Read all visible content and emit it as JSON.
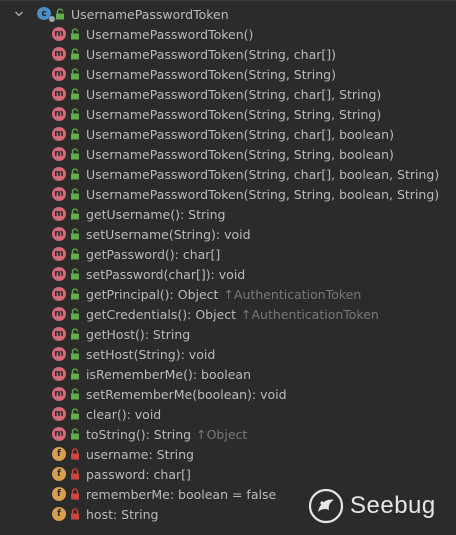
{
  "tree": {
    "root": {
      "label": "UsernamePasswordToken",
      "icon": "class-icon",
      "expanded": true
    },
    "members": [
      {
        "kind": "m",
        "access": "public",
        "label": "UsernamePasswordToken()",
        "inherited": ""
      },
      {
        "kind": "m",
        "access": "public",
        "label": "UsernamePasswordToken(String, char[])",
        "inherited": ""
      },
      {
        "kind": "m",
        "access": "public",
        "label": "UsernamePasswordToken(String, String)",
        "inherited": ""
      },
      {
        "kind": "m",
        "access": "public",
        "label": "UsernamePasswordToken(String, char[], String)",
        "inherited": ""
      },
      {
        "kind": "m",
        "access": "public",
        "label": "UsernamePasswordToken(String, String, String)",
        "inherited": ""
      },
      {
        "kind": "m",
        "access": "public",
        "label": "UsernamePasswordToken(String, char[], boolean)",
        "inherited": ""
      },
      {
        "kind": "m",
        "access": "public",
        "label": "UsernamePasswordToken(String, String, boolean)",
        "inherited": ""
      },
      {
        "kind": "m",
        "access": "public",
        "label": "UsernamePasswordToken(String, char[], boolean, String)",
        "inherited": ""
      },
      {
        "kind": "m",
        "access": "public",
        "label": "UsernamePasswordToken(String, String, boolean, String)",
        "inherited": ""
      },
      {
        "kind": "m",
        "access": "public",
        "label": "getUsername(): String",
        "inherited": ""
      },
      {
        "kind": "m",
        "access": "public",
        "label": "setUsername(String): void",
        "inherited": ""
      },
      {
        "kind": "m",
        "access": "public",
        "label": "getPassword(): char[]",
        "inherited": ""
      },
      {
        "kind": "m",
        "access": "public",
        "label": "setPassword(char[]): void",
        "inherited": ""
      },
      {
        "kind": "m",
        "access": "public",
        "label": "getPrincipal(): Object",
        "inherited": "↑AuthenticationToken"
      },
      {
        "kind": "m",
        "access": "public",
        "label": "getCredentials(): Object",
        "inherited": "↑AuthenticationToken"
      },
      {
        "kind": "m",
        "access": "public",
        "label": "getHost(): String",
        "inherited": ""
      },
      {
        "kind": "m",
        "access": "public",
        "label": "setHost(String): void",
        "inherited": ""
      },
      {
        "kind": "m",
        "access": "public",
        "label": "isRememberMe(): boolean",
        "inherited": ""
      },
      {
        "kind": "m",
        "access": "public",
        "label": "setRememberMe(boolean): void",
        "inherited": ""
      },
      {
        "kind": "m",
        "access": "public",
        "label": "clear(): void",
        "inherited": ""
      },
      {
        "kind": "m",
        "access": "public",
        "label": "toString(): String",
        "inherited": "↑Object"
      },
      {
        "kind": "f",
        "access": "private",
        "label": "username: String",
        "inherited": ""
      },
      {
        "kind": "f",
        "access": "private",
        "label": "password: char[]",
        "inherited": ""
      },
      {
        "kind": "f",
        "access": "private",
        "label": "rememberMe: boolean = false",
        "inherited": ""
      },
      {
        "kind": "f",
        "access": "private",
        "label": "host: String",
        "inherited": ""
      }
    ]
  },
  "watermark": {
    "text": "Seebug",
    "logo": "seebug-logo-icon"
  },
  "colors": {
    "background": "#2b2b2b",
    "text": "#bbbbbb",
    "inherited_text": "#787878",
    "method_badge": "#d5697a",
    "field_badge": "#d6a04f",
    "class_badge": "#4b8fc2",
    "public_lock": "#5fae4a",
    "private_lock": "#d2443d"
  }
}
